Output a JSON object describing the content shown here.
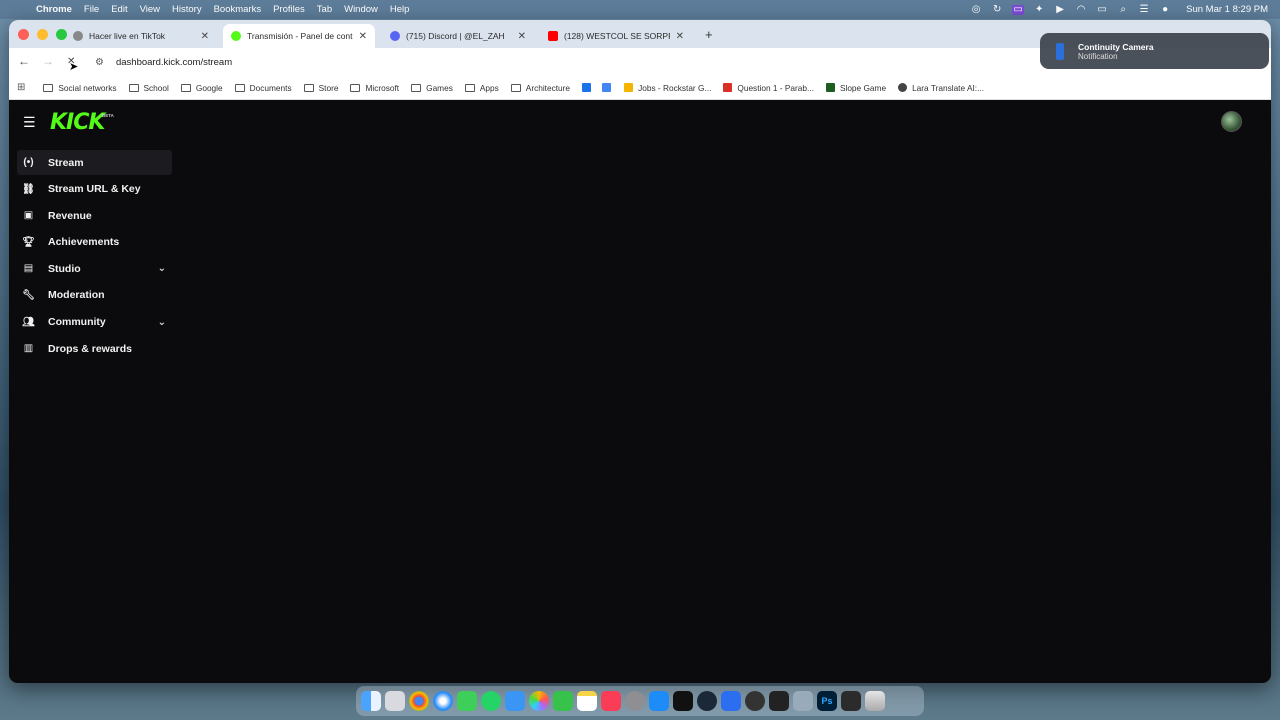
{
  "menubar": {
    "app_name": "Chrome",
    "menus": [
      "File",
      "Edit",
      "View",
      "History",
      "Bookmarks",
      "Profiles",
      "Tab",
      "Window",
      "Help"
    ],
    "clock": "Sun Mar 1  8:29 PM"
  },
  "tabs": [
    {
      "title": "Hacer live en TikTok",
      "favicon_color": "#888888",
      "active": false
    },
    {
      "title": "Transmisión - Panel de contro",
      "favicon_color": "#53fc18",
      "active": true
    },
    {
      "title": "(715) Discord | @EL_ZAH",
      "favicon_color": "#5865f2",
      "active": false
    },
    {
      "title": "(128) WESTCOL SE SORPRE",
      "favicon_color": "#ff0000",
      "active": false
    }
  ],
  "toolbar": {
    "url": "dashboard.kick.com/stream"
  },
  "bookmarks": [
    {
      "label": "Social networks",
      "type": "folder"
    },
    {
      "label": "School",
      "type": "folder"
    },
    {
      "label": "Google",
      "type": "folder"
    },
    {
      "label": "Documents",
      "type": "folder"
    },
    {
      "label": "Store",
      "type": "folder"
    },
    {
      "label": "Microsoft",
      "type": "folder"
    },
    {
      "label": "Games",
      "type": "folder"
    },
    {
      "label": "Apps",
      "type": "folder"
    },
    {
      "label": "Architecture",
      "type": "folder"
    },
    {
      "label": "",
      "type": "site",
      "color": "#1a73e8"
    },
    {
      "label": "",
      "type": "site",
      "color": "#4285f4"
    },
    {
      "label": "Jobs - Rockstar G...",
      "type": "site",
      "color": "#f4b400"
    },
    {
      "label": "Question 1 - Parab...",
      "type": "site",
      "color": "#d93025"
    },
    {
      "label": "Slope Game",
      "type": "site",
      "color": "#1b5e20"
    },
    {
      "label": "Lara Translate AI:...",
      "type": "site",
      "color": "#444444"
    }
  ],
  "kick": {
    "logo_text": "KICK",
    "beta_text": "BETA",
    "sidebar": [
      {
        "label": "Stream",
        "icon": "radio-icon",
        "active": true,
        "expandable": false
      },
      {
        "label": "Stream URL & Key",
        "icon": "link-icon",
        "active": false,
        "expandable": false
      },
      {
        "label": "Revenue",
        "icon": "wallet-icon",
        "active": false,
        "expandable": false
      },
      {
        "label": "Achievements",
        "icon": "trophy-icon",
        "active": false,
        "expandable": false
      },
      {
        "label": "Studio",
        "icon": "film-icon",
        "active": false,
        "expandable": true
      },
      {
        "label": "Moderation",
        "icon": "wrench-icon",
        "active": false,
        "expandable": false
      },
      {
        "label": "Community",
        "icon": "users-icon",
        "active": false,
        "expandable": true
      },
      {
        "label": "Drops & rewards",
        "icon": "gift-icon",
        "active": false,
        "expandable": false
      }
    ],
    "brand_color": "#53fc18"
  },
  "notification": {
    "title": "Continuity Camera",
    "body": "Notification"
  }
}
